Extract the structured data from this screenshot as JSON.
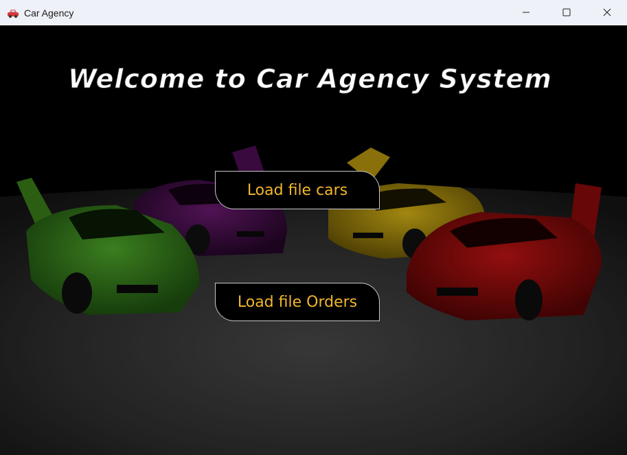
{
  "window": {
    "title": "Car Agency",
    "icon": "car-icon",
    "controls": [
      "minimize-icon",
      "maximize-icon",
      "close-icon"
    ]
  },
  "main": {
    "headline": "Welcome to Car Agency System",
    "buttons": {
      "load_cars": "Load file cars",
      "load_orders": "Load file Orders"
    }
  },
  "colors": {
    "button_text": "#f2b62d",
    "button_bg": "#000000",
    "titlebar_bg": "#eef1f7",
    "car_green": "#3f8a1c",
    "car_purple": "#5a1260",
    "car_yellow": "#c9a512",
    "car_red": "#b00d0d"
  }
}
